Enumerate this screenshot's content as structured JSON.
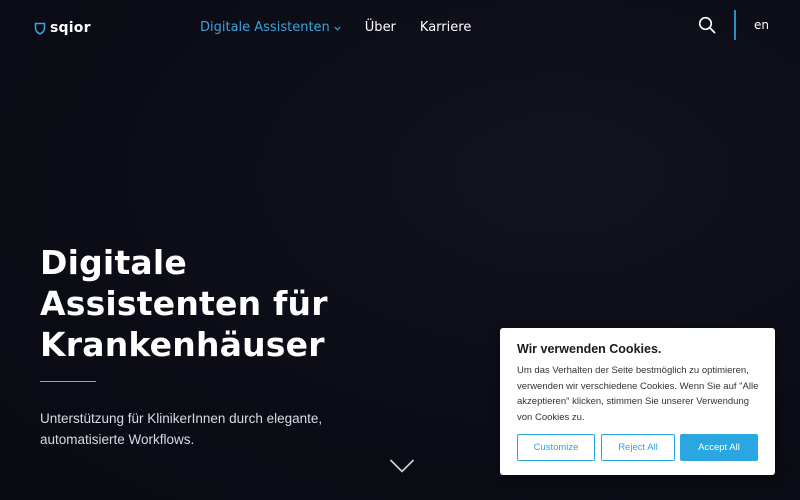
{
  "header": {
    "logo_text": "sqior",
    "nav": [
      {
        "label": "Digitale Assistenten",
        "active": true,
        "has_dropdown": true
      },
      {
        "label": "Über",
        "active": false,
        "has_dropdown": false
      },
      {
        "label": "Karriere",
        "active": false,
        "has_dropdown": false
      }
    ],
    "search_icon": "search-icon",
    "language": "en"
  },
  "hero": {
    "title": "Digitale Assistenten für Krankenhäuser",
    "subtitle": "Unterstützung für KlinikerInnen durch elegante, automatisierte Workflows.",
    "scroll_icon": "chevron-down-icon"
  },
  "cookie_banner": {
    "title": "Wir verwenden Cookies.",
    "text": "Um das Verhalten der Seite bestmöglich zu optimieren, verwenden wir verschiedene Cookies. Wenn Sie auf \"Alle akzeptieren\" klicken, stimmen Sie unserer Verwendung von Cookies zu.",
    "buttons": {
      "customize": "Customize",
      "reject": "Reject All",
      "accept": "Accept All"
    }
  },
  "colors": {
    "background": "#0b0c15",
    "accent": "#3aa3dc",
    "button_blue": "#2aa7e0",
    "text_light": "#ffffff"
  }
}
